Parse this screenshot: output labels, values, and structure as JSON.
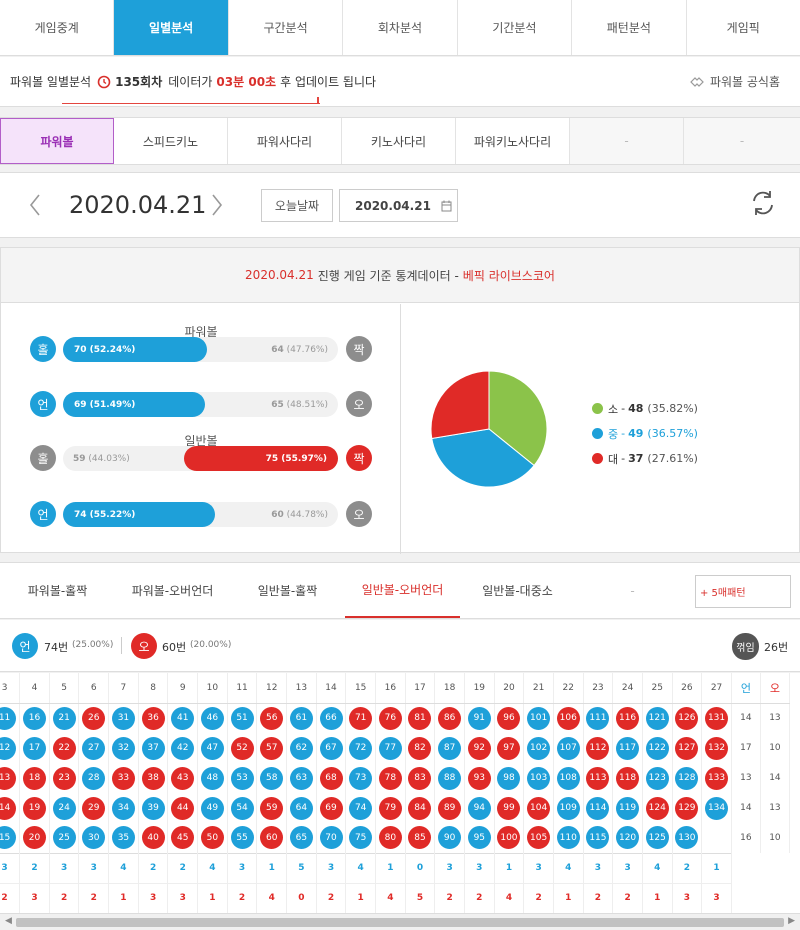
{
  "main_tabs": [
    "게임중계",
    "일별분석",
    "구간분석",
    "회차분석",
    "기간분석",
    "패턴분석",
    "게임픽"
  ],
  "notice": {
    "prefix": "파워볼 일별분석",
    "round": "135회차",
    "mid": "데이터가",
    "time": "03분 00초",
    "suffix": "후 업데이트 됩니다",
    "official": "파워볼 공식홈"
  },
  "game_tabs": [
    "파워볼",
    "스피드키노",
    "파워사다리",
    "키노사다리",
    "파워키노사다리",
    "-",
    "-"
  ],
  "date": {
    "current": "2020.04.21",
    "today_label": "오늘날짜",
    "picker_value": "2020.04.21"
  },
  "stats": {
    "head_date": "2020.04.21",
    "head_text": "진행 게임 기준 통계데이터 -",
    "head_brand": "베픽 라이브스코어",
    "section_powerball": "파워볼",
    "section_normal": "일반볼",
    "rows": [
      {
        "left_label": "홀",
        "left_value": "70",
        "left_pct": "(52.24%)",
        "right_value": "64",
        "right_pct": "(47.76%)",
        "right_label": "짝",
        "fill": 0.5224,
        "win": "left"
      },
      {
        "left_label": "언",
        "left_value": "69",
        "left_pct": "(51.49%)",
        "right_value": "65",
        "right_pct": "(48.51%)",
        "right_label": "오",
        "fill": 0.5149,
        "win": "left"
      },
      {
        "left_label": "홀",
        "left_value": "59",
        "left_pct": "(44.03%)",
        "right_value": "75",
        "right_pct": "(55.97%)",
        "right_label": "짝",
        "fill": 0.5597,
        "win": "right"
      },
      {
        "left_label": "언",
        "left_value": "74",
        "left_pct": "(55.22%)",
        "right_value": "60",
        "right_pct": "(44.78%)",
        "right_label": "오",
        "fill": 0.5522,
        "win": "left"
      }
    ],
    "colors": {
      "blue": "#1ea0d9",
      "red": "#e02a27",
      "green": "#8bc34a"
    }
  },
  "chart_data": {
    "type": "pie",
    "categories": [
      "소",
      "중",
      "대"
    ],
    "values": [
      48,
      49,
      37
    ],
    "percents": [
      "(35.82%)",
      "(36.57%)",
      "(27.61%)"
    ],
    "colors": [
      "#8bc34a",
      "#1ea0d9",
      "#e02a27"
    ]
  },
  "sub_tabs": [
    "파워볼-홀짝",
    "파워볼-오버언더",
    "일반볼-홀짝",
    "일반볼-오버언더",
    "일반볼-대중소",
    "-"
  ],
  "pattern_button": "+ 5매패턴",
  "summary": {
    "under_label": "언",
    "under_count": "74번",
    "under_pct": "(25.00%)",
    "over_label": "오",
    "over_count": "60번",
    "over_pct": "(20.00%)",
    "mixed_label": "꺾임",
    "mixed_count": "26번"
  },
  "grid": {
    "columns": [
      "3",
      "4",
      "5",
      "6",
      "7",
      "8",
      "9",
      "10",
      "11",
      "12",
      "13",
      "14",
      "15",
      "16",
      "17",
      "18",
      "19",
      "20",
      "21",
      "22",
      "23",
      "24",
      "25",
      "26",
      "27"
    ],
    "under_header": "언",
    "over_header": "오",
    "rows": [
      {
        "balls": [
          "11",
          "16",
          "21",
          "26",
          "31",
          "36",
          "41",
          "46",
          "51",
          "56",
          "61",
          "66",
          "71",
          "76",
          "81",
          "86",
          "91",
          "96",
          "101",
          "106",
          "111",
          "116",
          "121",
          "126",
          "131"
        ],
        "colors": [
          "b",
          "b",
          "b",
          "r",
          "b",
          "r",
          "b",
          "b",
          "b",
          "r",
          "b",
          "b",
          "r",
          "r",
          "r",
          "r",
          "b",
          "r",
          "b",
          "r",
          "b",
          "r",
          "b",
          "r",
          "r"
        ],
        "under": "14",
        "over": "13"
      },
      {
        "balls": [
          "12",
          "17",
          "22",
          "27",
          "32",
          "37",
          "42",
          "47",
          "52",
          "57",
          "62",
          "67",
          "72",
          "77",
          "82",
          "87",
          "92",
          "97",
          "102",
          "107",
          "112",
          "117",
          "122",
          "127",
          "132"
        ],
        "colors": [
          "b",
          "b",
          "r",
          "b",
          "b",
          "b",
          "b",
          "b",
          "r",
          "r",
          "b",
          "b",
          "b",
          "b",
          "r",
          "b",
          "r",
          "r",
          "b",
          "b",
          "r",
          "b",
          "b",
          "r",
          "r"
        ],
        "under": "17",
        "over": "10"
      },
      {
        "balls": [
          "13",
          "18",
          "23",
          "28",
          "33",
          "38",
          "43",
          "48",
          "53",
          "58",
          "63",
          "68",
          "73",
          "78",
          "83",
          "88",
          "93",
          "98",
          "103",
          "108",
          "113",
          "118",
          "123",
          "128",
          "133"
        ],
        "colors": [
          "r",
          "r",
          "r",
          "b",
          "r",
          "r",
          "r",
          "b",
          "b",
          "b",
          "b",
          "r",
          "b",
          "r",
          "r",
          "b",
          "r",
          "b",
          "b",
          "b",
          "r",
          "r",
          "b",
          "b",
          "r"
        ],
        "under": "13",
        "over": "14"
      },
      {
        "balls": [
          "14",
          "19",
          "24",
          "29",
          "34",
          "39",
          "44",
          "49",
          "54",
          "59",
          "64",
          "69",
          "74",
          "79",
          "84",
          "89",
          "94",
          "99",
          "104",
          "109",
          "114",
          "119",
          "124",
          "129",
          "134"
        ],
        "colors": [
          "r",
          "r",
          "b",
          "r",
          "b",
          "b",
          "r",
          "b",
          "b",
          "r",
          "b",
          "r",
          "b",
          "r",
          "r",
          "r",
          "b",
          "r",
          "r",
          "b",
          "b",
          "b",
          "r",
          "r",
          "b"
        ],
        "under": "14",
        "over": "13"
      },
      {
        "balls": [
          "15",
          "20",
          "25",
          "30",
          "35",
          "40",
          "45",
          "50",
          "55",
          "60",
          "65",
          "70",
          "75",
          "80",
          "85",
          "90",
          "95",
          "100",
          "105",
          "110",
          "115",
          "120",
          "125",
          "130",
          ""
        ],
        "colors": [
          "b",
          "r",
          "b",
          "b",
          "b",
          "r",
          "r",
          "r",
          "b",
          "r",
          "b",
          "b",
          "b",
          "r",
          "r",
          "b",
          "b",
          "r",
          "r",
          "b",
          "b",
          "b",
          "b",
          "b",
          ""
        ],
        "under": "16",
        "over": "10"
      }
    ],
    "under_totals": [
      "3",
      "2",
      "3",
      "3",
      "4",
      "2",
      "2",
      "4",
      "3",
      "1",
      "5",
      "3",
      "4",
      "1",
      "0",
      "3",
      "3",
      "1",
      "3",
      "4",
      "3",
      "3",
      "4",
      "2",
      "1"
    ],
    "over_totals": [
      "2",
      "3",
      "2",
      "2",
      "1",
      "3",
      "3",
      "1",
      "2",
      "4",
      "0",
      "2",
      "1",
      "4",
      "5",
      "2",
      "2",
      "4",
      "2",
      "1",
      "2",
      "2",
      "1",
      "3",
      "3"
    ]
  }
}
